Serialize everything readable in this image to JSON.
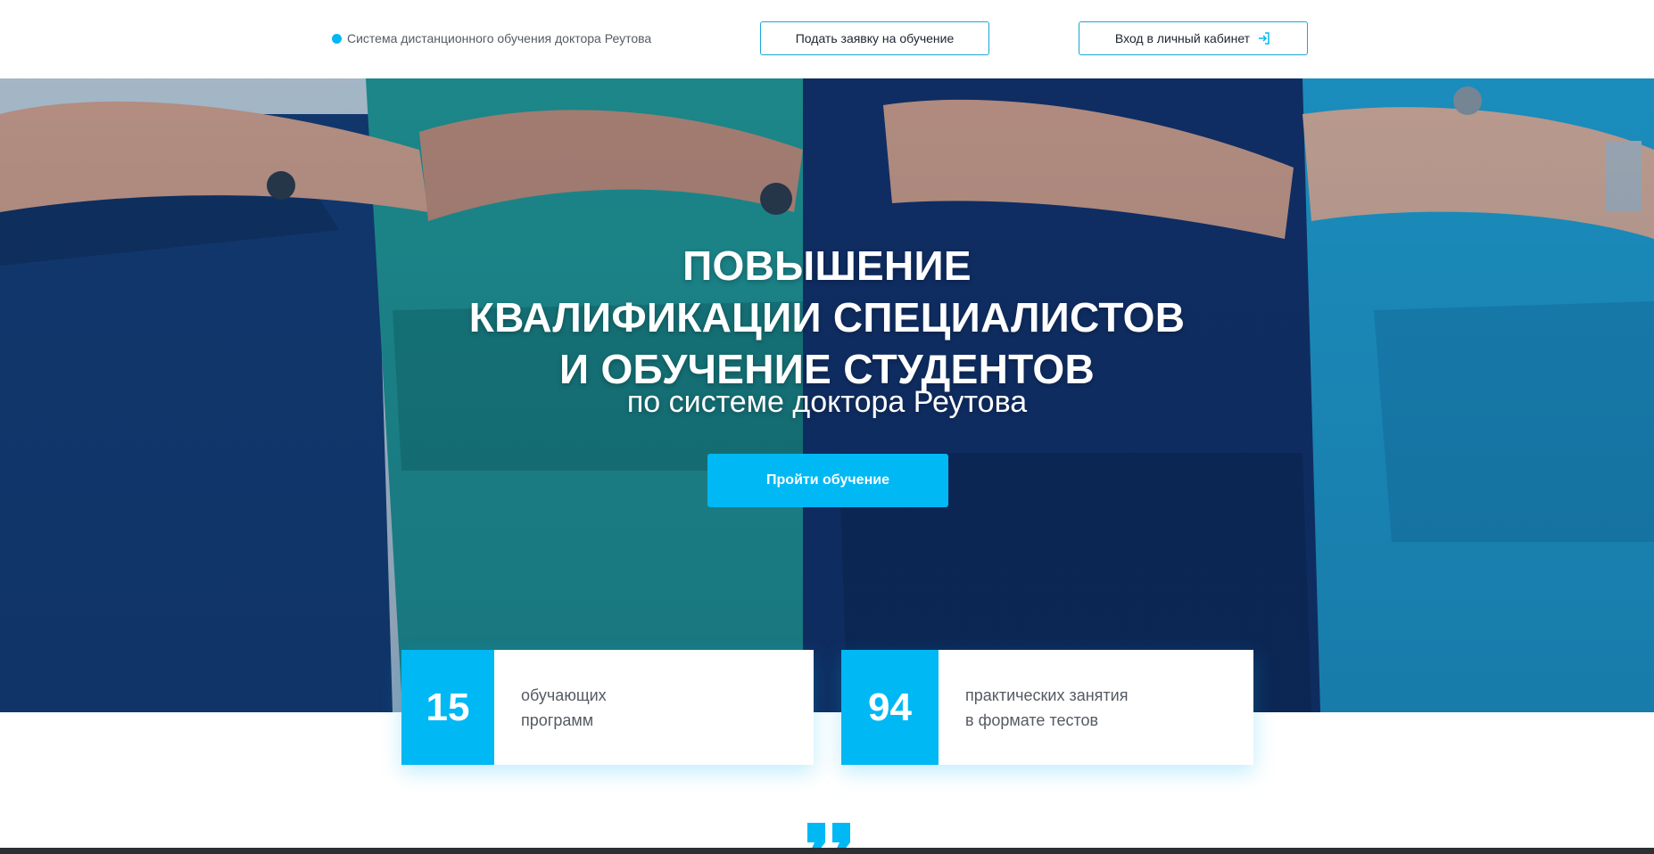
{
  "header": {
    "brand_text": "Система дистанционного обучения доктора Реутова",
    "apply_label": "Подать заявку на обучение",
    "login_label": "Вход в личный кабинет"
  },
  "hero": {
    "title_lines": [
      "ПОВЫШЕНИЕ",
      "КВАЛИФИКАЦИИ СПЕЦИАЛИСТОВ",
      "И ОБУЧЕНИЕ СТУДЕНТОВ"
    ],
    "subtitle": "по системе доктора Реутова",
    "cta_label": "Пройти обучение",
    "image_subject": "medical-staff-in-scrubs-arms-crossed"
  },
  "stats": [
    {
      "number": "15",
      "line1": "обучающих",
      "line2": "программ"
    },
    {
      "number": "94",
      "line1": "практических занятия",
      "line2": "в формате тестов"
    }
  ],
  "colors": {
    "accent": "#00b8f4",
    "text": "#555b63",
    "dark": "#1d2430"
  },
  "icons": {
    "brand": "dot-icon",
    "login": "login-arrow-icon",
    "quote": "quote-icon"
  }
}
